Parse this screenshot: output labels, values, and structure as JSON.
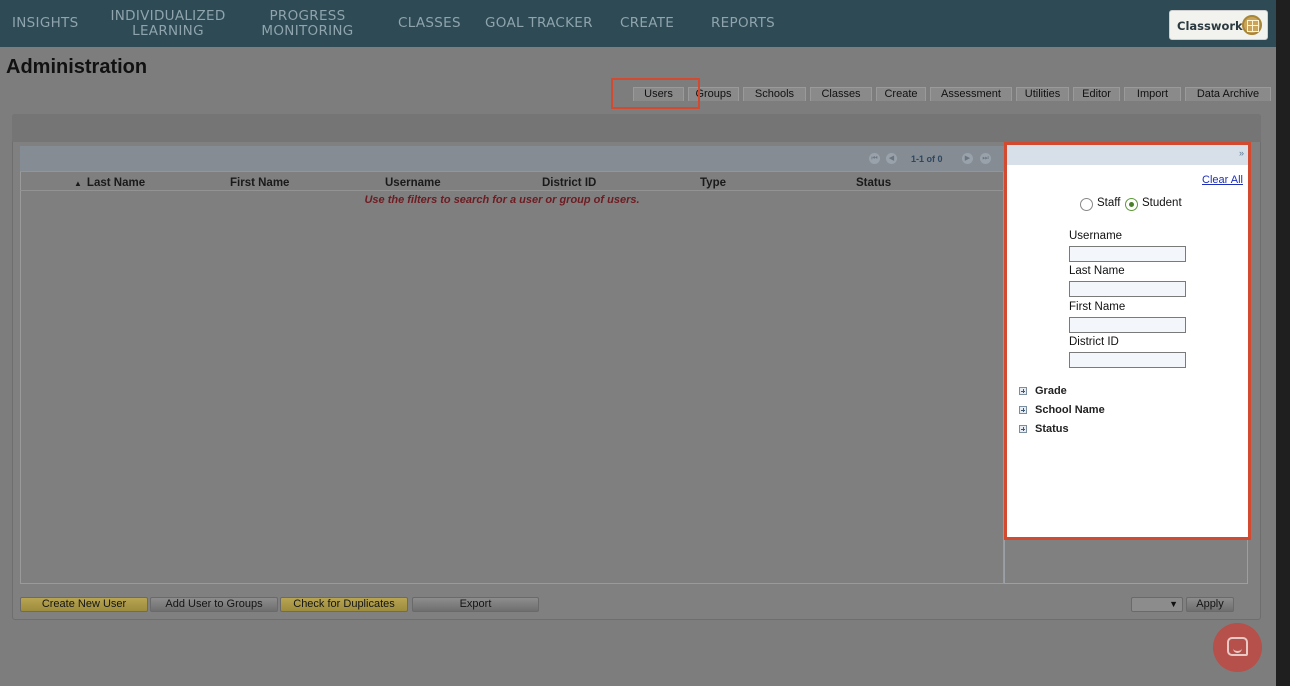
{
  "nav": {
    "items": [
      {
        "label": "INSIGHTS"
      },
      {
        "label_line1": "INDIVIDUALIZED",
        "label_line2": "LEARNING"
      },
      {
        "label_line1": "PROGRESS",
        "label_line2": "MONITORING"
      },
      {
        "label": "CLASSES"
      },
      {
        "label": "GOAL TRACKER"
      },
      {
        "label": "CREATE"
      },
      {
        "label": "REPORTS"
      }
    ],
    "brand": "Classworks"
  },
  "page": {
    "title": "Administration"
  },
  "tabs": [
    {
      "label": "Users",
      "active": true
    },
    {
      "label": "Groups"
    },
    {
      "label": "Schools"
    },
    {
      "label": "Classes"
    },
    {
      "label": "Create"
    },
    {
      "label": "Assessment"
    },
    {
      "label": "Utilities"
    },
    {
      "label": "Editor"
    },
    {
      "label": "Import"
    },
    {
      "label": "Data Archive"
    }
  ],
  "grid": {
    "pager_text": "1-1 of 0",
    "columns": [
      "Last Name",
      "First Name",
      "Username",
      "District ID",
      "Type",
      "Status"
    ],
    "empty_message": "Use the filters to search for a user or group of users."
  },
  "filters": {
    "clear_all": "Clear All",
    "collapse_icon": "»",
    "user_type": {
      "options": [
        "Staff",
        "Student"
      ],
      "selected": "Student"
    },
    "fields": [
      {
        "label": "Username",
        "value": ""
      },
      {
        "label": "Last Name",
        "value": ""
      },
      {
        "label": "First Name",
        "value": ""
      },
      {
        "label": "District ID",
        "value": ""
      }
    ],
    "expanders": [
      "Grade",
      "School Name",
      "Status"
    ]
  },
  "actions": {
    "create_new_user": "Create New User",
    "add_user_to_groups": "Add User to Groups",
    "check_for_duplicates": "Check for Duplicates",
    "export": "Export",
    "apply": "Apply",
    "action_select_value": ""
  },
  "colors": {
    "nav_bg": "#2e4a55",
    "highlight": "#d24a30",
    "gold_button": "#b7a553",
    "empty_message": "#6d1c22"
  }
}
